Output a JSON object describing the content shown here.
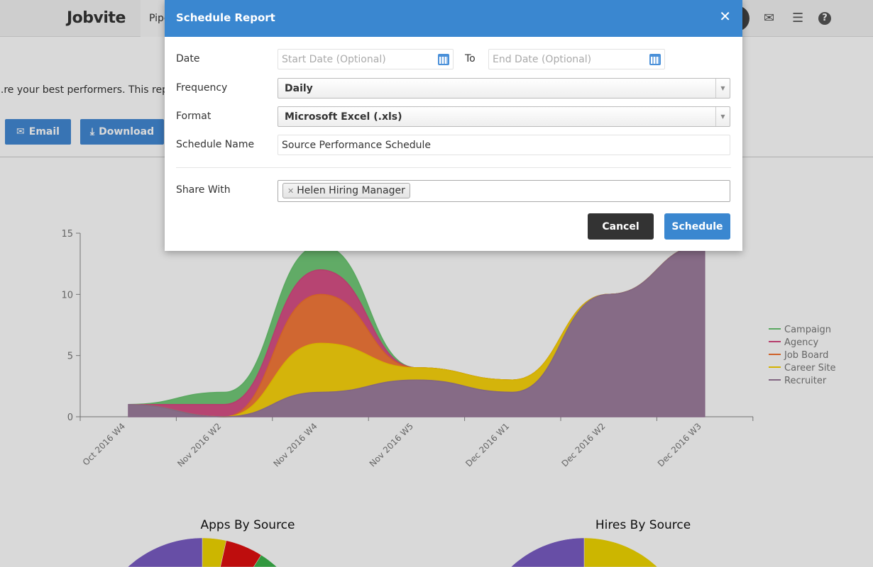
{
  "header": {
    "logo": "Jobvite",
    "nav_item": "Pipeline",
    "icons": [
      "envelope-icon",
      "ordered-list-icon",
      "help-icon"
    ]
  },
  "page": {
    "description": "...re your best performers. This report",
    "email_label": "Email",
    "download_label": "Download"
  },
  "colors": {
    "campaign": "#6ac671",
    "agency": "#d6487f",
    "job_board": "#f4732f",
    "career_site": "#f9d200",
    "recruiter": "#997799",
    "modal_header": "#3a87d0",
    "primary": "#3a87d0",
    "cancel": "#333333"
  },
  "chart_data": [
    {
      "type": "area",
      "stacked": true,
      "categories": [
        "Oct 2016 W4",
        "Nov 2016 W2",
        "Nov 2016 W4",
        "Nov 2016 W5",
        "Dec 2016 W1",
        "Dec 2016 W2",
        "Dec 2016 W3"
      ],
      "yticks": [
        "0",
        "5",
        "10",
        "15"
      ],
      "ylim": [
        0,
        15
      ],
      "legend_position": "right",
      "series": [
        {
          "name": "Recruiter",
          "values": [
            1,
            0,
            2,
            3,
            2,
            10,
            14
          ]
        },
        {
          "name": "Career Site",
          "values": [
            0,
            0,
            4,
            1,
            1,
            0,
            0
          ]
        },
        {
          "name": "Job Board",
          "values": [
            0,
            0,
            4,
            0,
            0,
            0,
            0
          ]
        },
        {
          "name": "Agency",
          "values": [
            0,
            1,
            2,
            0,
            0,
            0,
            0
          ]
        },
        {
          "name": "Campaign",
          "values": [
            0,
            1,
            2,
            0,
            0,
            0,
            0
          ]
        }
      ],
      "legend": [
        "Campaign",
        "Agency",
        "Job Board",
        "Career Site",
        "Recruiter"
      ]
    },
    {
      "type": "pie",
      "title": "Apps By Source",
      "slices": [
        {
          "source": "Career Site",
          "fraction": 0.035
        },
        {
          "source": "Agency",
          "fraction": 0.055
        },
        {
          "source": "Campaign",
          "fraction": 0.06
        },
        {
          "source": "Job Board",
          "fraction": 0.2
        },
        {
          "source": "Recruiter",
          "fraction": 0.65
        }
      ]
    },
    {
      "type": "pie",
      "title": "Hires By Source",
      "slices": [
        {
          "source": "Career Site",
          "fraction": 0.45
        },
        {
          "source": "Job Board",
          "fraction": 0.2
        },
        {
          "source": "Recruiter",
          "fraction": 0.35
        }
      ]
    }
  ],
  "modal": {
    "title": "Schedule Report",
    "date_label": "Date",
    "start_placeholder": "Start Date (Optional)",
    "to_label": "To",
    "end_placeholder": "End Date (Optional)",
    "frequency_label": "Frequency",
    "frequency_value": "Daily",
    "format_label": "Format",
    "format_value": "Microsoft Excel (.xls)",
    "name_label": "Schedule Name",
    "name_value": "Source Performance Schedule",
    "share_label": "Share With",
    "share_tags": [
      "Helen Hiring Manager"
    ],
    "cancel_label": "Cancel",
    "schedule_label": "Schedule"
  }
}
